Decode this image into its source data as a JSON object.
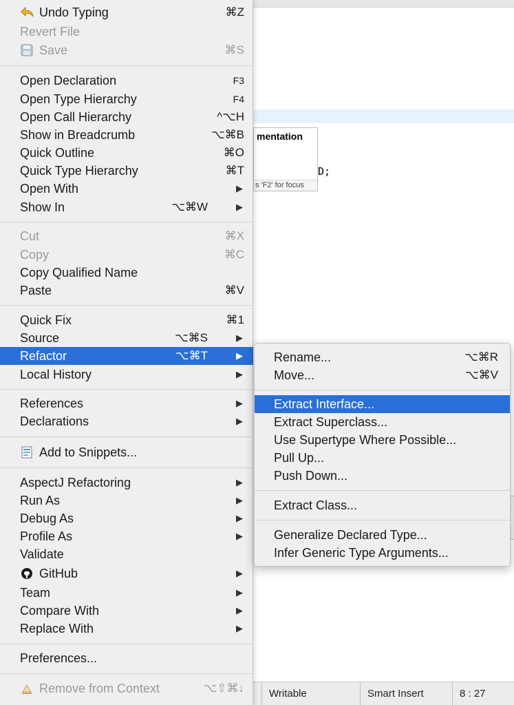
{
  "editor": {
    "tooltip_title": "mentation",
    "tooltip_hint": "s 'F2' for focus",
    "code_fragment": "D;"
  },
  "statusbar": {
    "writable": "Writable",
    "insert_mode": "Smart Insert",
    "position": "8 : 27"
  },
  "menu": {
    "undo": {
      "label": "Undo Typing",
      "shortcut": "⌘Z",
      "icon": "undo-arrow-icon"
    },
    "revert": {
      "label": "Revert File"
    },
    "save": {
      "label": "Save",
      "shortcut": "⌘S",
      "icon": "floppy-disk-icon"
    },
    "open_declaration": {
      "label": "Open Declaration",
      "shortcut": "F3"
    },
    "open_type_hierarchy": {
      "label": "Open Type Hierarchy",
      "shortcut": "F4"
    },
    "open_call_hierarchy": {
      "label": "Open Call Hierarchy",
      "shortcut": "^⌥H"
    },
    "show_in_breadcrumb": {
      "label": "Show in Breadcrumb",
      "shortcut": "⌥⌘B"
    },
    "quick_outline": {
      "label": "Quick Outline",
      "shortcut": "⌘O"
    },
    "quick_type_hierarchy": {
      "label": "Quick Type Hierarchy",
      "shortcut": "⌘T"
    },
    "open_with": {
      "label": "Open With"
    },
    "show_in": {
      "label": "Show In",
      "shortcut": "⌥⌘W"
    },
    "cut": {
      "label": "Cut",
      "shortcut": "⌘X"
    },
    "copy": {
      "label": "Copy",
      "shortcut": "⌘C"
    },
    "copy_qualified_name": {
      "label": "Copy Qualified Name"
    },
    "paste": {
      "label": "Paste",
      "shortcut": "⌘V"
    },
    "quick_fix": {
      "label": "Quick Fix",
      "shortcut": "⌘1"
    },
    "source": {
      "label": "Source",
      "shortcut": "⌥⌘S"
    },
    "refactor": {
      "label": "Refactor",
      "shortcut": "⌥⌘T"
    },
    "local_history": {
      "label": "Local History"
    },
    "references": {
      "label": "References"
    },
    "declarations": {
      "label": "Declarations"
    },
    "add_to_snippets": {
      "label": "Add to Snippets...",
      "icon": "snippets-icon"
    },
    "aspectj_refactoring": {
      "label": "AspectJ Refactoring"
    },
    "run_as": {
      "label": "Run As"
    },
    "debug_as": {
      "label": "Debug As"
    },
    "profile_as": {
      "label": "Profile As"
    },
    "validate": {
      "label": "Validate"
    },
    "github": {
      "label": "GitHub",
      "icon": "github-icon"
    },
    "team": {
      "label": "Team"
    },
    "compare_with": {
      "label": "Compare With"
    },
    "replace_with": {
      "label": "Replace With"
    },
    "preferences": {
      "label": "Preferences..."
    },
    "remove_from_context": {
      "label": "Remove from Context",
      "shortcut": "⌥⇧⌘↓",
      "icon": "remove-context-icon"
    }
  },
  "submenu": {
    "rename": {
      "label": "Rename...",
      "shortcut": "⌥⌘R"
    },
    "move": {
      "label": "Move...",
      "shortcut": "⌥⌘V"
    },
    "extract_interface": {
      "label": "Extract Interface..."
    },
    "extract_superclass": {
      "label": "Extract Superclass..."
    },
    "use_supertype": {
      "label": "Use Supertype Where Possible..."
    },
    "pull_up": {
      "label": "Pull Up..."
    },
    "push_down": {
      "label": "Push Down..."
    },
    "extract_class": {
      "label": "Extract Class..."
    },
    "generalize_declared_type": {
      "label": "Generalize Declared Type..."
    },
    "infer_generic_type_arguments": {
      "label": "Infer Generic Type Arguments..."
    }
  },
  "colors": {
    "selection": "#2a6fd8",
    "menu_bg": "#efefef",
    "disabled_text": "#9b9b9b"
  },
  "arrow_glyph": "▶"
}
